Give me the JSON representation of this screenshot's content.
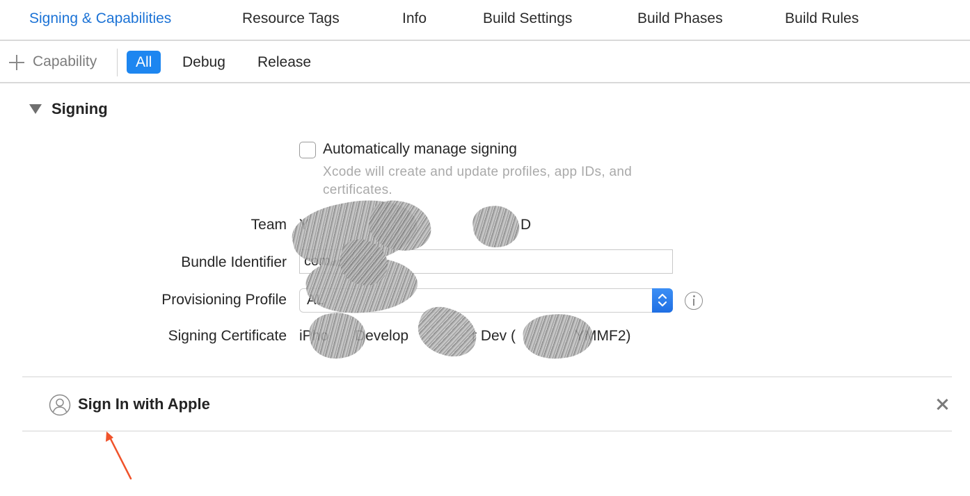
{
  "tabs": [
    {
      "label": "Signing & Capabilities",
      "active": true
    },
    {
      "label": "Resource Tags",
      "active": false
    },
    {
      "label": "Info",
      "active": false
    },
    {
      "label": "Build Settings",
      "active": false
    },
    {
      "label": "Build Phases",
      "active": false
    },
    {
      "label": "Build Rules",
      "active": false
    }
  ],
  "filterbar": {
    "add_capability_label": "Capability",
    "add_icon": "plus-icon",
    "segments": [
      {
        "label": "All",
        "active": true
      },
      {
        "label": "Debug",
        "active": false
      },
      {
        "label": "Release",
        "active": false
      }
    ]
  },
  "signing": {
    "title": "Signing",
    "auto_manage": {
      "label": "Automatically manage signing",
      "checked": false,
      "help": "Xcode will create and update profiles, app IDs, and certificates."
    },
    "fields": {
      "team_label": "Team",
      "team_value": "Y",
      "team_value_end": "D",
      "bundle_label": "Bundle Identifier",
      "bundle_value": "com.",
      "profile_label": "Provisioning Profile",
      "profile_value": "AL",
      "certificate_label": "Signing Certificate",
      "certificate_value_start": "iPho",
      "certificate_value_mid": "Develop",
      "certificate_value_mid2": "r Dev (",
      "certificate_value_end": "YMMF2)"
    }
  },
  "capability": {
    "title": "Sign In with Apple",
    "icon": "person-circle-icon",
    "remove_icon": "close-icon"
  },
  "colors": {
    "accent": "#1c73d6",
    "segment_active": "#1d86f0",
    "annotation_arrow": "#f0532b"
  }
}
